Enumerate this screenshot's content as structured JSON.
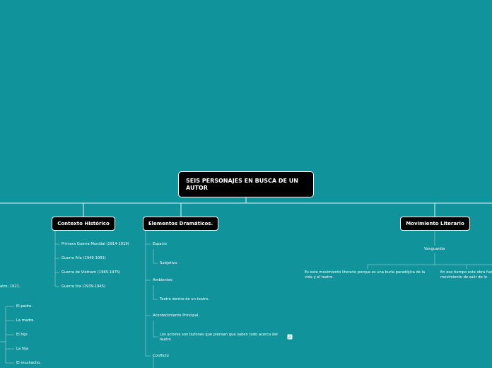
{
  "root": {
    "title": "SEIS PERSONAJES EN BUSCA DE UN AUTOR"
  },
  "categories": {
    "contexto": {
      "label": "Contexto Histórico",
      "items": [
        "Primera Guerra Mundial (1914-1919)",
        "Guerra Fría (1946-1991)",
        "Guerra de Vietnam (1965-1975)",
        "Guerra fria (1939-1945)"
      ]
    },
    "elementos": {
      "label": "Elementos Dramáticos.",
      "items": [
        {
          "label": "Espacio",
          "child": "Subjetivo."
        },
        {
          "label": "Ambientes",
          "child": "Teatro dentro de un teatro."
        },
        {
          "label": "Acontecimiento Principal.",
          "child": "Los actores son bufones que piensan que saben todo acerca del teatro"
        },
        {
          "label": "Conflicto",
          "child": ""
        }
      ]
    },
    "movimiento": {
      "label": "Movimiento Literario",
      "sub": "Vanguardia",
      "left_text": "Es este movimiento literario porque es una burla paradójica de la vida y el teatro.",
      "right_text": "En ese tiempo este obra fue un movimiento de salir de lo"
    }
  },
  "left_branch": {
    "fragment": "atro: 1921.",
    "items": [
      "El padre.",
      "La madre.",
      "El hijo",
      "La hija",
      "El muchacho."
    ]
  },
  "colors": {
    "background": "#11939b",
    "node": "#000000",
    "line": "#ffffff",
    "text": "#ffffff"
  },
  "icons": {
    "note": "note-icon"
  }
}
